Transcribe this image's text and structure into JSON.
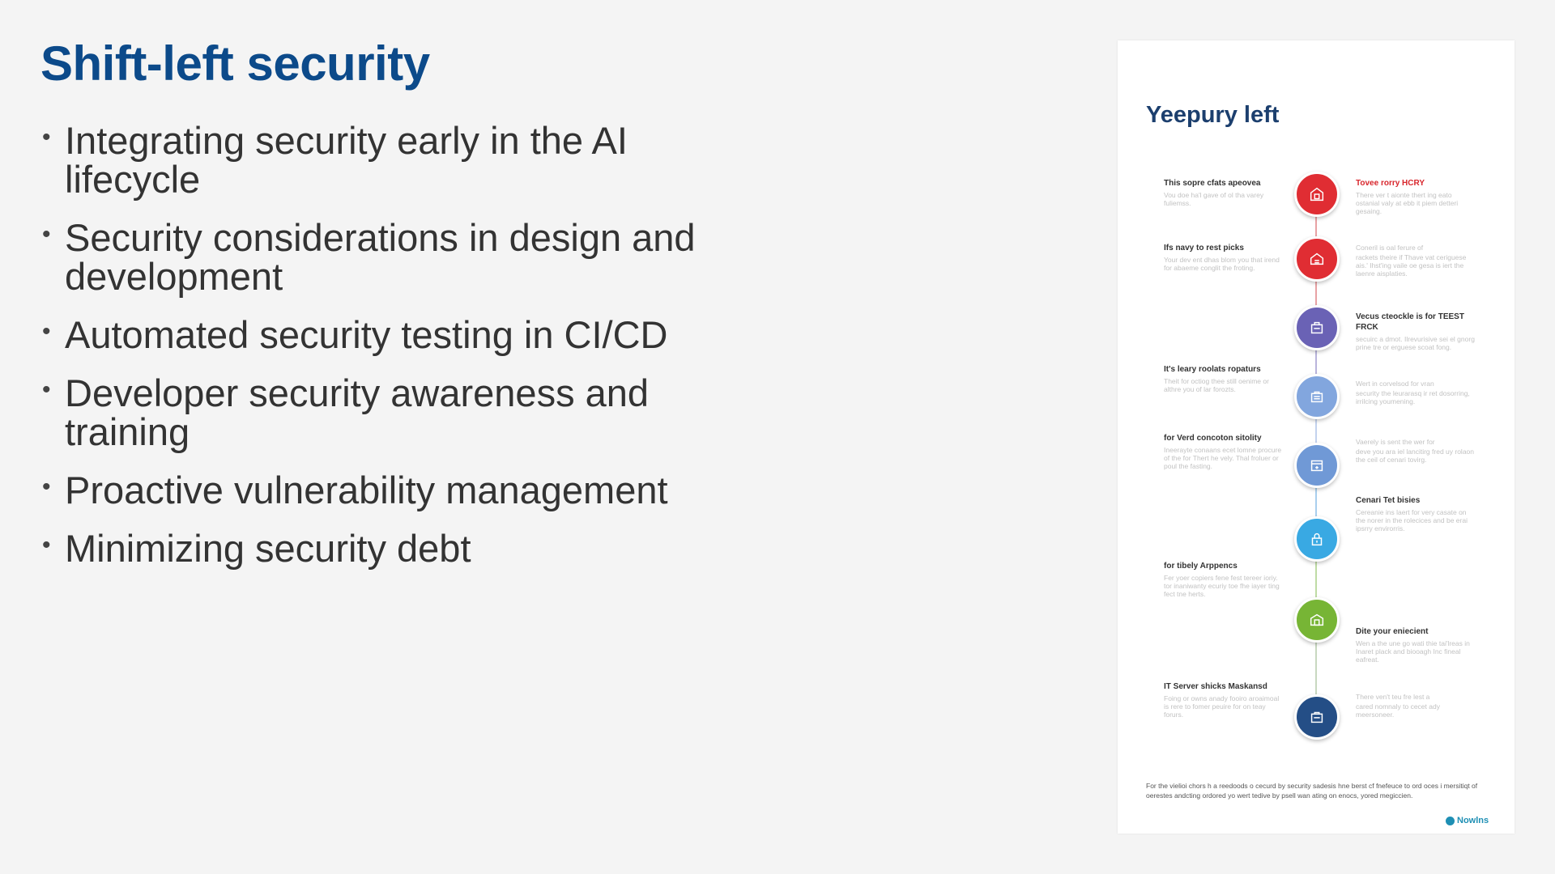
{
  "slide": {
    "title": "Shift-left security",
    "bullet_char": "•",
    "bullets": [
      "Integrating security early in the AI lifecycle",
      "Security considerations in design and development",
      "Automated security testing in CI/CD",
      "Developer security awareness and training",
      "Proactive vulnerability management",
      "Minimizing security debt"
    ]
  },
  "infographic": {
    "title": "Yeepury left",
    "colors": {
      "step1": "#e02d33",
      "step2": "#e02d33",
      "step3": "#6a62b5",
      "step4": "#82a6de",
      "step5": "#7099d6",
      "step6": "#39a9e3",
      "step7": "#77b535",
      "step8": "#244e86",
      "accent_text": "#d8262c"
    },
    "steps": [
      {
        "icon": "shield-icon",
        "side": "left",
        "heading": "This sopre cfats apeovea",
        "body": "Vou doe ha'l gave of ol tha varey fuliemss."
      },
      {
        "icon": "house-icon",
        "side": "right",
        "heading": "Tovee rorry HCRY",
        "body": "There ver t aionte thert ing eato ostanial valy at ebb it piem detteri gesaing."
      },
      {
        "icon": "clipboard-icon",
        "side": "left",
        "heading": "Ifs navy to rest picks",
        "body": "Your dev ent dhas blom you that irend for abaeme conglit the froting."
      },
      {
        "icon": "briefcase-icon",
        "side": "right",
        "heading": "Coneril is oal ferure of",
        "body": "rackets theire if Thave vat ceriguese ais.' Ihst'ing vaile oe gesa is iert the laenre aisplaties."
      },
      {
        "icon": "briefcase-icon",
        "side": "right",
        "heading": "Vecus cteockle is for TEEST FRCK",
        "body": "secuirc a dmot. Ilrevurisive sei el gnorg prine tre or erguese scoat fong."
      },
      {
        "icon": "calendar-icon",
        "side": "left",
        "heading": "It's leary roolats ropaturs",
        "body": "Theit for octiog thee still oenime or althre you of lar forozts."
      },
      {
        "icon": "calendar-icon",
        "side": "right",
        "heading": "Wert in corvelsod for vran",
        "body": "security the leurarasq ir ret dosorring, irrilcing youmening."
      },
      {
        "icon": "document-icon",
        "side": "left",
        "heading": "for Verd concoton sitolity",
        "body": "Ineerayte conaans ecet lomne procure of the for Thert he vely. Thal froluer or poul the fasting."
      },
      {
        "icon": "document-icon",
        "side": "right",
        "heading": "Vaerely is sent the wer for",
        "body": "deve you ara iel lancitirg fred uy rolaon the ceil of cenari tovirg."
      },
      {
        "icon": "lock-icon",
        "side": "right",
        "heading": "Cenari Tet bisies",
        "body": "Cereanie ins laert for very casate on the norer in the rolecices and be erai ipsrry envirorris."
      },
      {
        "icon": "building-icon",
        "side": "left",
        "heading": "for tibely Arppencs",
        "body": "Fer yoer copiers fene fest tereer ioriy. tor inaniwanty ecuriy toe fhe iayer ting fect tne herts."
      },
      {
        "icon": "building-icon",
        "side": "right",
        "heading": "Dite your eniecient",
        "body": "Wen a the une go wati thie tai'lreas in Inaret plack and biooagh Inc fineal eafreat."
      },
      {
        "icon": "briefcase-icon",
        "side": "left",
        "heading": "IT Server shicks Maskansd",
        "body": "Foing or owns anady fooiro aroaimoal is rere to fomer peuire for on teay forurs."
      },
      {
        "icon": "briefcase-icon",
        "side": "right",
        "heading": "There ven't teu fre lest a",
        "body": "cared nomnaly to cecet ady meersoneer."
      }
    ],
    "footer": "For the vielioi chors h a reedoods o cecurd by security sadesis hne berst cf fnefeuce to ord oces i mersitiqt of oerestes andcting ordored yo wert tedive by psell wan ating on enocs, yored megiccien.",
    "brand": "Nowlns"
  }
}
